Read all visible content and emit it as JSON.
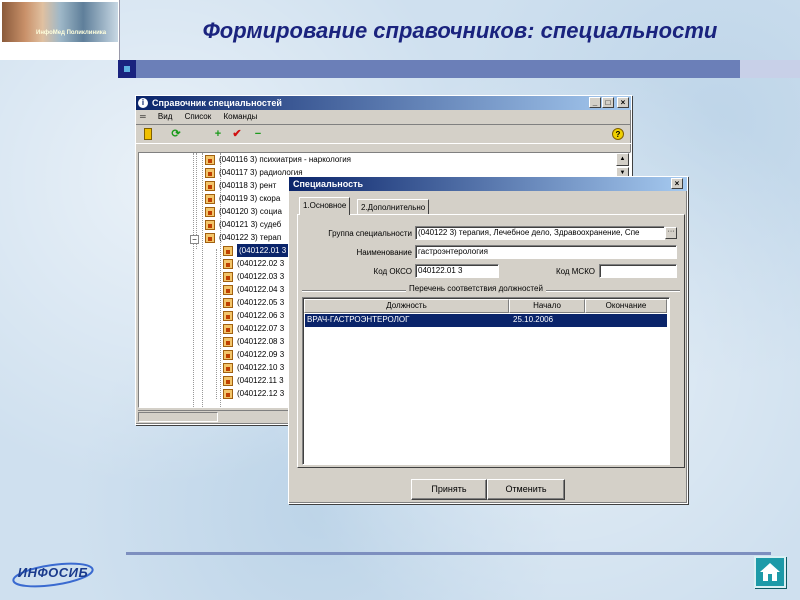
{
  "slide": {
    "title": "Формирование справочников: специальности",
    "footer_logo": "ИНФОСИБ",
    "logo_title": "ИнфоМед Поликлиника"
  },
  "main_window": {
    "title": "Справочник специальностей",
    "menu": [
      "Вид",
      "Список",
      "Команды"
    ],
    "tree_items": [
      "(040116 3) психиатрия - наркология",
      "(040117 3) радиология",
      "(040118 3) рент",
      "(040119 3) скора",
      "(040120 3) социа",
      "(040121 3) судеб",
      "(040122 3) терап",
      "(040122.01 3",
      "(040122.02 3",
      "(040122.03 3",
      "(040122.04 3",
      "(040122.05 3",
      "(040122.06 3",
      "(040122.07 3",
      "(040122.08 3",
      "(040122.09 3",
      "(040122.10 3",
      "(040122.11 3",
      "(040122.12 3"
    ]
  },
  "dialog": {
    "title": "Специальность",
    "tabs": [
      "1.Основное",
      "2.Дополнительно"
    ],
    "fields": {
      "group_label": "Группа специальности",
      "group_value": "(040122 3) терапия, Лечебное дело, Здравоохранение, Спе",
      "name_label": "Наименование",
      "name_value": "гастроэнтерология",
      "okso_label": "Код ОКСО",
      "okso_value": "040122.01 3",
      "msko_label": "Код МСКО",
      "msko_value": ""
    },
    "positions_title": "Перечень соответствия должностей",
    "columns": [
      "Должность",
      "Начало",
      "Окончание"
    ],
    "rows": [
      {
        "position": "ВРАЧ-ГАСТРОЭНТЕРОЛОГ",
        "start": "25.10.2006",
        "end": ""
      }
    ],
    "ok_label": "Принять",
    "cancel_label": "Отменить"
  },
  "colors": {
    "title_text": "#1a237e",
    "titlebar": "#0a246a",
    "selection": "#0a246a",
    "home_button": "#1d9aa8"
  }
}
